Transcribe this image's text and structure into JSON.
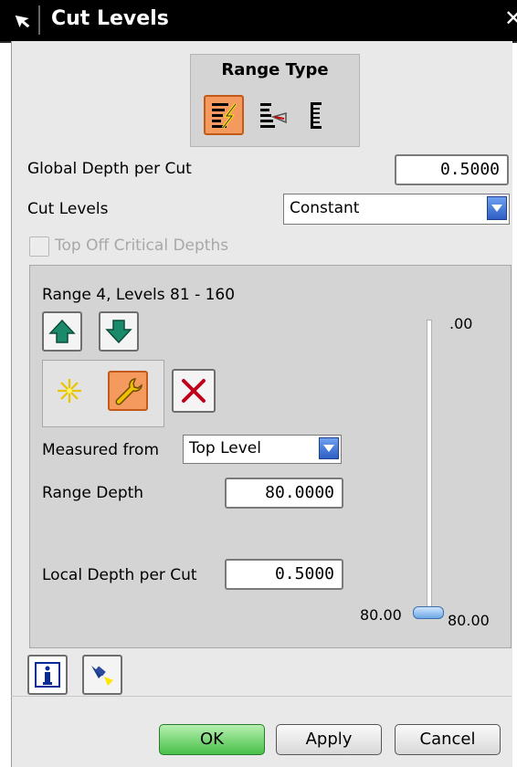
{
  "window": {
    "title": "Cut Levels",
    "close_glyph": "✕"
  },
  "range_type": {
    "label": "Range Type",
    "options": [
      {
        "icon": "user-defined-range-icon",
        "selected": true
      },
      {
        "icon": "single-range-icon",
        "selected": false
      },
      {
        "icon": "single-level-icon",
        "selected": false
      }
    ]
  },
  "global_depth": {
    "label": "Global Depth per Cut",
    "value": "0.5000"
  },
  "cut_levels": {
    "label": "Cut Levels",
    "selected": "Constant"
  },
  "top_off": {
    "label": "Top Off Critical Depths",
    "checked": false,
    "enabled": false
  },
  "range": {
    "heading": "Range 4,  Levels 81 - 160",
    "measured_from": {
      "label": "Measured from",
      "selected": "Top Level"
    },
    "range_depth": {
      "label": "Range Depth",
      "value": "80.0000"
    },
    "local_depth": {
      "label": "Local Depth per Cut",
      "value": "0.5000"
    },
    "slider": {
      "top_label": ".00",
      "left_label": "80.00",
      "right_label": "80.00",
      "position_fraction": 1.0
    }
  },
  "footer": {
    "ok_label": "OK",
    "apply_label": "Apply",
    "cancel_label": "Cancel"
  },
  "colors": {
    "titlebar": "#000000",
    "active_button": "#f59a5e",
    "arrow_green": "#1a8a6a",
    "ok_button": "#48c048",
    "dropdown": "#2c5fc4"
  }
}
